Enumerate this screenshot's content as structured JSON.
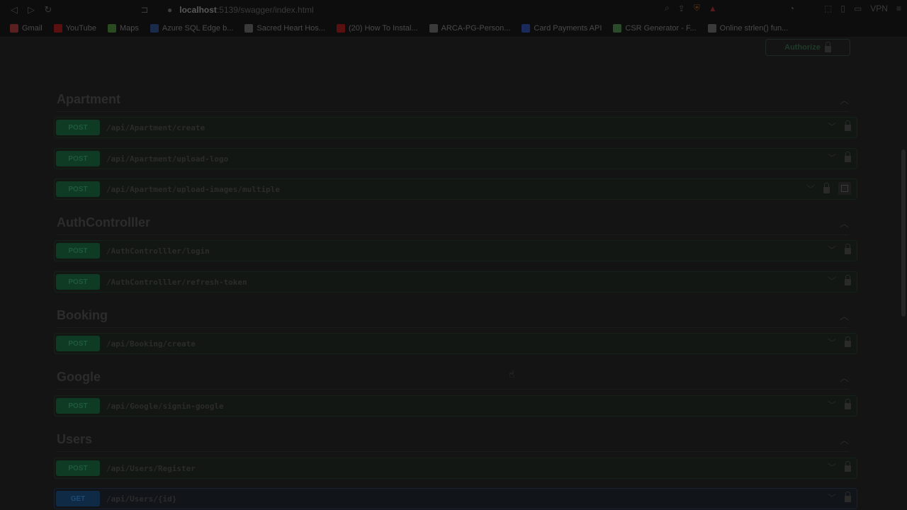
{
  "browser": {
    "url_host": "localhost",
    "url_path": ":5139/swagger/index.html",
    "vpn_label": "VPN"
  },
  "bookmarks": [
    {
      "label": "Gmail",
      "color": "#5a2020"
    },
    {
      "label": "YouTube",
      "color": "#5a1010"
    },
    {
      "label": "Maps",
      "color": "#2a4a20"
    },
    {
      "label": "Azure SQL Edge b...",
      "color": "#1a2a4a"
    },
    {
      "label": "Sacred Heart Hos...",
      "color": "#3a3a3a"
    },
    {
      "label": "(20) How To Instal...",
      "color": "#5a1010"
    },
    {
      "label": "ARCA-PG-Person...",
      "color": "#3a3a3a"
    },
    {
      "label": "Card Payments API",
      "color": "#1a2a5a"
    },
    {
      "label": "CSR Generator - F...",
      "color": "#2a4a2a"
    },
    {
      "label": "Online strlen() fun...",
      "color": "#3a3a3a"
    }
  ],
  "authorize_label": "Authorize",
  "sections": [
    {
      "title": "Apartment",
      "ops": [
        {
          "method": "POST",
          "path": "/api/Apartment/create"
        },
        {
          "method": "POST",
          "path": "/api/Apartment/upload-logo"
        },
        {
          "method": "POST",
          "path": "/api/Apartment/upload-images/multiple"
        }
      ]
    },
    {
      "title": "AuthControlller",
      "ops": [
        {
          "method": "POST",
          "path": "/AuthControlller/login"
        },
        {
          "method": "POST",
          "path": "/AuthControlller/refresh-token"
        }
      ]
    },
    {
      "title": "Booking",
      "ops": [
        {
          "method": "POST",
          "path": "/api/Booking/create"
        }
      ]
    },
    {
      "title": "Google",
      "ops": [
        {
          "method": "POST",
          "path": "/api/Google/signin-google"
        }
      ]
    },
    {
      "title": "Users",
      "ops": [
        {
          "method": "POST",
          "path": "/api/Users/Register"
        },
        {
          "method": "GET",
          "path": "/api/Users/{id}"
        }
      ]
    }
  ]
}
